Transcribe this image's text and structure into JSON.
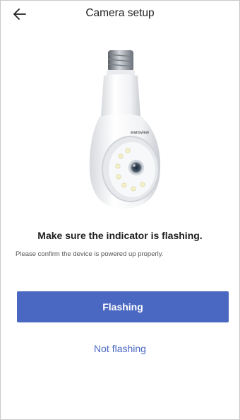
{
  "header": {
    "title": "Camera setup",
    "back_icon": "arrow-left-icon"
  },
  "device": {
    "brand_text": "wansview",
    "image_icon": "bulb-camera-icon"
  },
  "instructions": {
    "headline": "Make sure the indicator is flashing.",
    "subtext": "Please confirm the device is powered up properly."
  },
  "actions": {
    "primary_label": "Flashing",
    "secondary_label": "Not flashing"
  },
  "colors": {
    "accent": "#4a68c1",
    "text": "#1f1f1f"
  }
}
